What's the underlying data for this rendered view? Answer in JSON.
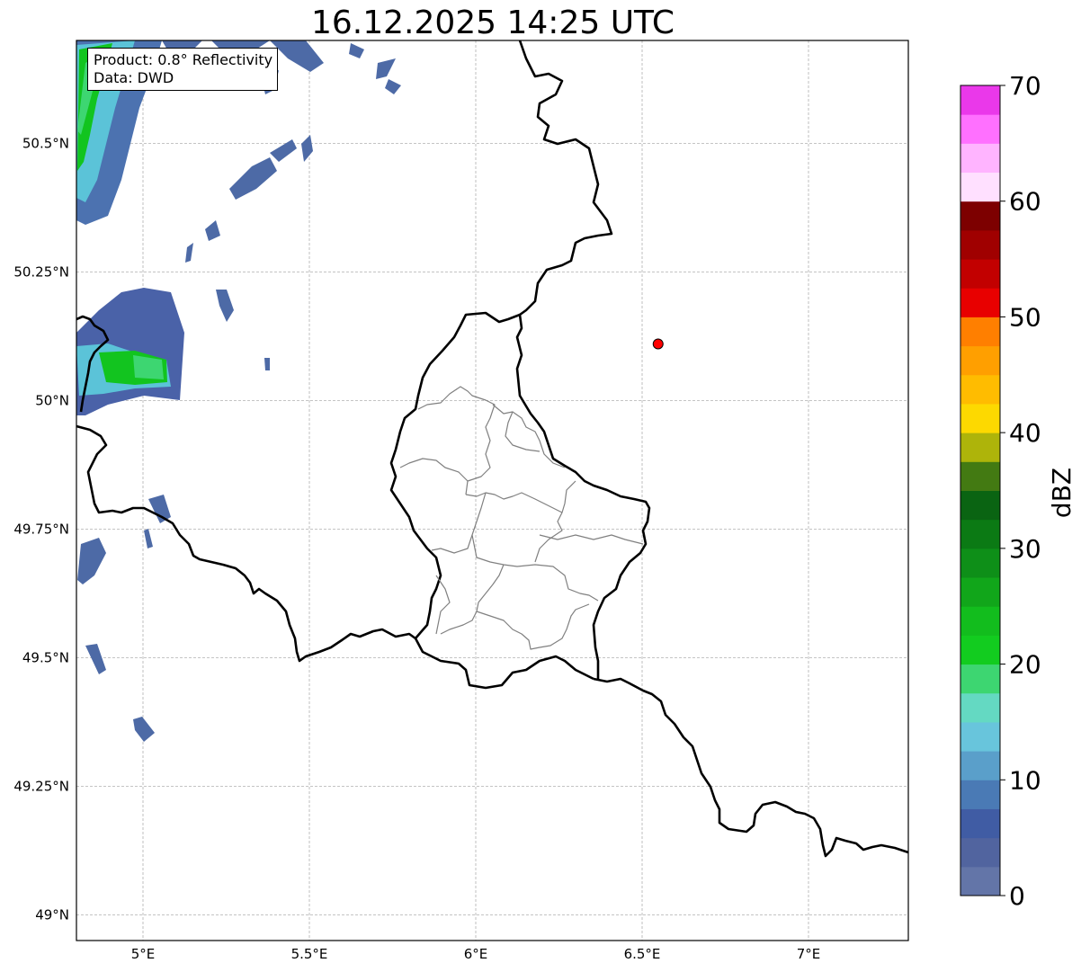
{
  "title": "16.12.2025 14:25 UTC",
  "info": {
    "product": "Product: 0.8° Reflectivity",
    "data": "Data: DWD"
  },
  "map": {
    "lon_range": [
      4.8,
      7.3
    ],
    "lat_range": [
      48.95,
      50.7
    ],
    "lon_ticks": [
      {
        "value": 5.0,
        "label": "5°E"
      },
      {
        "value": 5.5,
        "label": "5.5°E"
      },
      {
        "value": 6.0,
        "label": "6°E"
      },
      {
        "value": 6.5,
        "label": "6.5°E"
      },
      {
        "value": 7.0,
        "label": "7°E"
      }
    ],
    "lat_ticks": [
      {
        "value": 50.5,
        "label": "50.5°N"
      },
      {
        "value": 50.25,
        "label": "50.25°N"
      },
      {
        "value": 50.0,
        "label": "50°N"
      },
      {
        "value": 49.75,
        "label": "49.75°N"
      },
      {
        "value": 49.5,
        "label": "49.5°N"
      },
      {
        "value": 49.25,
        "label": "49.25°N"
      },
      {
        "value": 49.0,
        "label": "49°N"
      }
    ],
    "gridlines": true,
    "radar_marker": {
      "lon": 6.548,
      "lat": 50.11,
      "color": "#ff0000"
    }
  },
  "colorbar": {
    "label": "dBZ",
    "min": 0,
    "max": 70,
    "ticks": [
      0,
      10,
      20,
      30,
      40,
      50,
      60,
      70
    ],
    "bands": [
      "#6375a8",
      "#51649f",
      "#405ca4",
      "#4a7ab5",
      "#5a9fca",
      "#68c5dc",
      "#64d9c2",
      "#3dd671",
      "#12cc1f",
      "#12bd1d",
      "#11a61a",
      "#0e8f18",
      "#0b7a14",
      "#0a6412",
      "#437a12",
      "#aeb40a",
      "#fdd900",
      "#ffbc00",
      "#ff9f00",
      "#ff7f00",
      "#e80000",
      "#c20000",
      "#a00000",
      "#7d0000",
      "#ffe0ff",
      "#ffb4ff",
      "#ff70ff",
      "#ea38ea"
    ]
  }
}
